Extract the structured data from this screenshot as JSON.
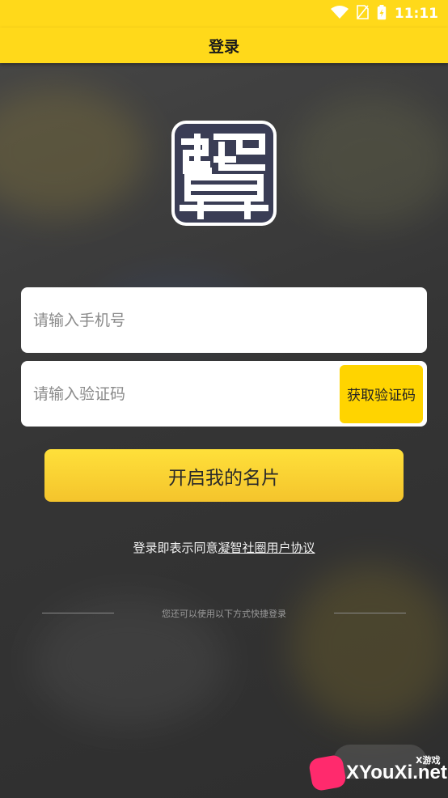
{
  "status_bar": {
    "time": "11:11"
  },
  "header": {
    "title": "登录"
  },
  "phone_field": {
    "placeholder": "请输入手机号"
  },
  "code_field": {
    "placeholder": "请输入验证码",
    "button_label": "获取验证码"
  },
  "submit_label": "开启我的名片",
  "agreement": {
    "prefix": "登录即表示同意",
    "link": "凝智社圈用户协议"
  },
  "alt_login": {
    "label": "您还可以使用以下方式快捷登录"
  },
  "watermark": {
    "text": "XYouXi.net",
    "small": "X游戏"
  },
  "colors": {
    "accent": "#ffd91a",
    "button": "#f4c42c",
    "background": "#3a3a3a"
  }
}
